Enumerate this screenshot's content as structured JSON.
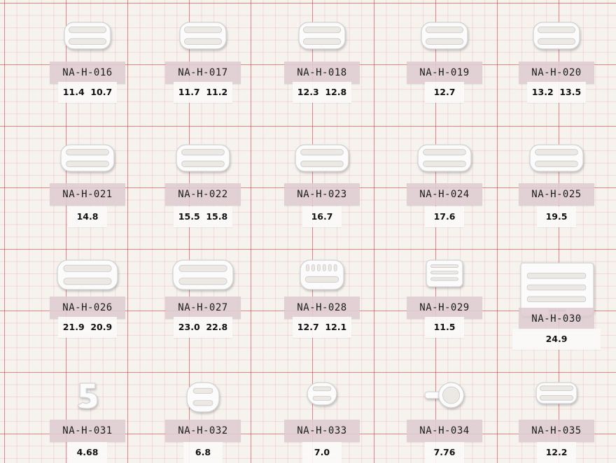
{
  "items": [
    {
      "code": "NA-H-016",
      "size": "11.4  10.7",
      "shape": "strap-8"
    },
    {
      "code": "NA-H-017",
      "size": "11.7  11.2",
      "shape": "strap-8"
    },
    {
      "code": "NA-H-018",
      "size": "12.3  12.8",
      "shape": "strap-8"
    },
    {
      "code": "NA-H-019",
      "size": "12.7",
      "shape": "strap-8"
    },
    {
      "code": "NA-H-020",
      "size": "13.2  13.5",
      "shape": "strap-8"
    },
    {
      "code": "NA-H-021",
      "size": "14.8",
      "shape": "strap-8"
    },
    {
      "code": "NA-H-022",
      "size": "15.5  15.8",
      "shape": "strap-8"
    },
    {
      "code": "NA-H-023",
      "size": "16.7",
      "shape": "strap-8"
    },
    {
      "code": "NA-H-024",
      "size": "17.6",
      "shape": "strap-8"
    },
    {
      "code": "NA-H-025",
      "size": "19.5",
      "shape": "strap-8"
    },
    {
      "code": "NA-H-026",
      "size": "21.9  20.9",
      "shape": "strap-8"
    },
    {
      "code": "NA-H-027",
      "size": "23.0  22.8",
      "shape": "strap-8"
    },
    {
      "code": "NA-H-028",
      "size": "12.7  12.1",
      "shape": "toothed-slider"
    },
    {
      "code": "NA-H-029",
      "size": "11.5",
      "shape": "bar-slider"
    },
    {
      "code": "NA-H-030",
      "size": "24.9",
      "shape": "hook-slider"
    },
    {
      "code": "NA-H-031",
      "size": "4.68",
      "shape": "small-hook"
    },
    {
      "code": "NA-H-032",
      "size": "6.8",
      "shape": "small-8"
    },
    {
      "code": "NA-H-033",
      "size": "7.0",
      "shape": "small-8"
    },
    {
      "code": "NA-H-034",
      "size": "7.76",
      "shape": "ring"
    },
    {
      "code": "NA-H-035",
      "size": "12.2",
      "shape": "strap-8"
    }
  ]
}
